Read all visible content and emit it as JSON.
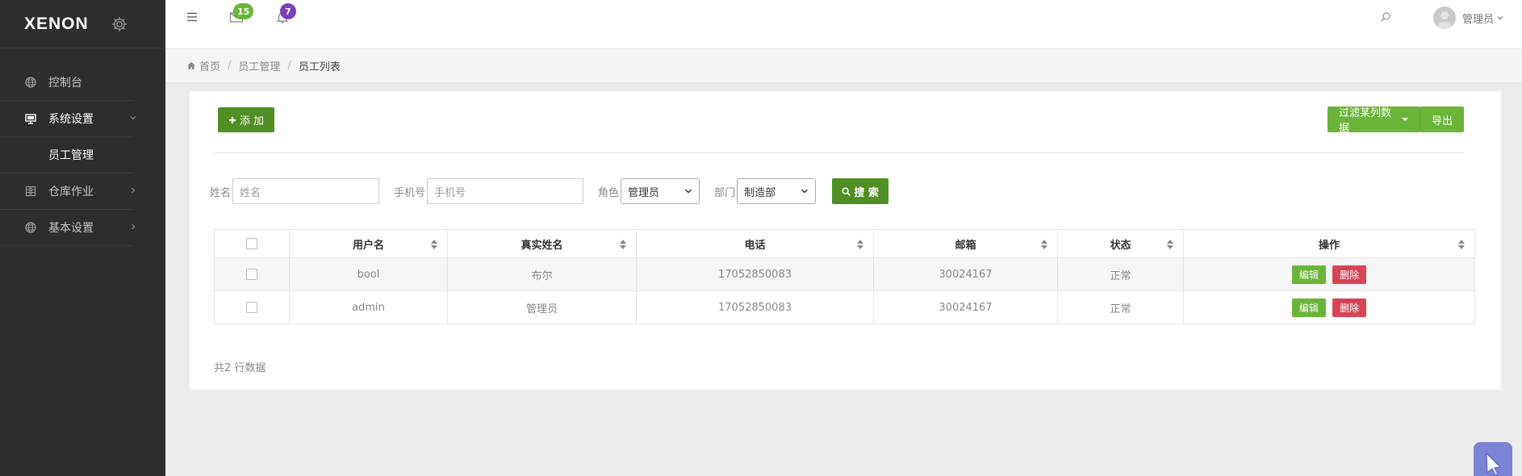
{
  "brand": {
    "logo": "XENON"
  },
  "sidebar": {
    "items": [
      {
        "label": "控制台",
        "icon": "globe-icon"
      },
      {
        "label": "系统设置",
        "icon": "monitor-icon"
      },
      {
        "label": "员工管理",
        "sub": true
      },
      {
        "label": "仓库作业",
        "icon": "archive-icon"
      },
      {
        "label": "基本设置",
        "icon": "globe-icon"
      }
    ]
  },
  "topbar": {
    "mail_count": "15",
    "bell_count": "7",
    "mail_badge_color": "#6bb43a",
    "bell_badge_color": "#7b3fb8",
    "user_name": "管理员"
  },
  "breadcrumb": {
    "home": "首页",
    "level1": "员工管理",
    "current": "员工列表"
  },
  "actions": {
    "add_label": "添 加",
    "filter_label": "过滤某列数据",
    "export_label": "导出"
  },
  "search": {
    "name_label": "姓名",
    "name_placeholder": "姓名",
    "phone_label": "手机号",
    "phone_placeholder": "手机号",
    "role_label": "角色",
    "role_value": "管理员",
    "dept_label": "部门",
    "dept_value": "制造部",
    "search_label": "搜 索"
  },
  "table": {
    "columns": [
      "用户名",
      "真实姓名",
      "电话",
      "邮箱",
      "状态",
      "操作"
    ],
    "rows": [
      {
        "username": "bool",
        "realname": "布尔",
        "phone": "17052850083",
        "email": "30024167",
        "status": "正常"
      },
      {
        "username": "admin",
        "realname": "管理员",
        "phone": "17052850083",
        "email": "30024167",
        "status": "正常"
      }
    ],
    "edit_label": "编辑",
    "delete_label": "删除"
  },
  "footer": {
    "row_count_text": "共2 行数据"
  },
  "colors": {
    "sidebar_bg": "#2b2d2e",
    "primary_green": "#4f8f23",
    "light_green": "#6bb43a",
    "danger_red": "#d64555"
  }
}
